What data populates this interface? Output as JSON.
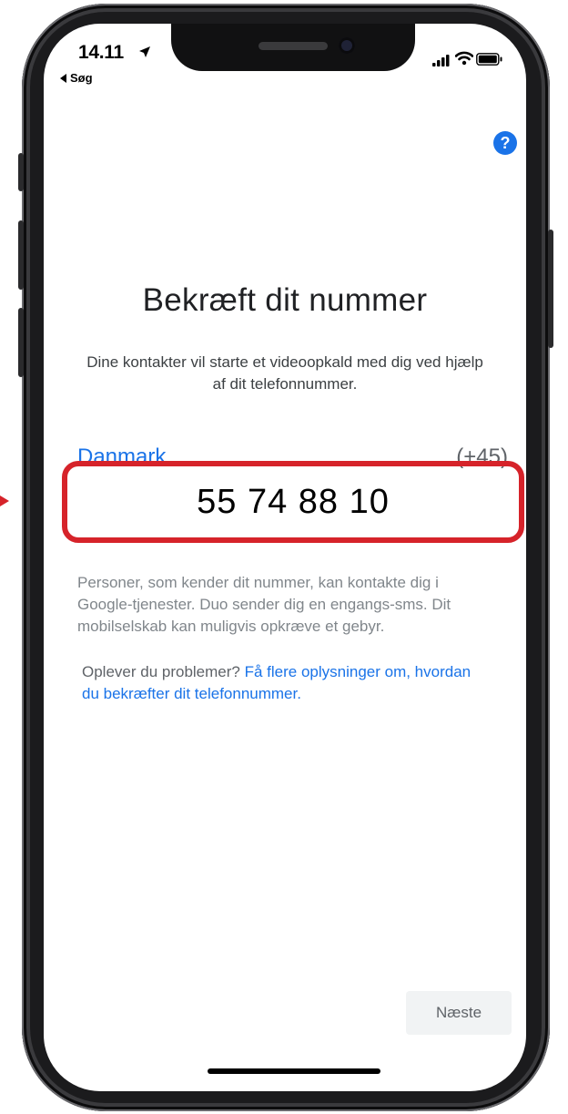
{
  "status_bar": {
    "time": "14.11",
    "back_label": "Søg"
  },
  "page": {
    "title": "Bekræft dit nummer",
    "subtitle": "Dine kontakter vil starte et videoopkald med dig ved hjælp af dit telefonnummer."
  },
  "country": {
    "name": "Danmark",
    "code": "(+45)"
  },
  "phone_number": {
    "value": "55 74 88 10"
  },
  "disclaimer": "Personer, som kender dit nummer, kan kontakte dig i Google-tjenester. Duo sender dig en engangs-sms. Dit mobilselskab kan muligvis opkræve et gebyr.",
  "help": {
    "prefix": "Oplever du problemer? ",
    "link_text": "Få flere oplysninger om, hvordan du bekræfter dit telefonnummer."
  },
  "buttons": {
    "next_label": "Næste",
    "help_icon": "?"
  },
  "colors": {
    "accent": "#1a73e8",
    "highlight": "#d6232a"
  },
  "icons": [
    "location-arrow-icon",
    "back-triangle-icon",
    "signal-icon",
    "wifi-icon",
    "battery-icon",
    "help-icon",
    "annotation-arrow-icon"
  ]
}
